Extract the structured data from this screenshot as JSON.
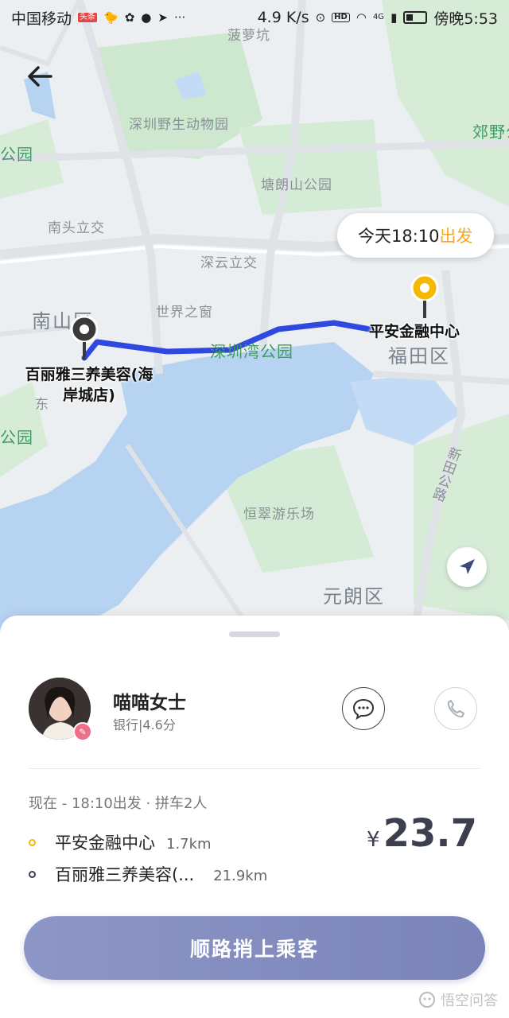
{
  "status_bar": {
    "carrier": "中国移动",
    "news_badge": "头条",
    "speed": "4.9 K/s",
    "network": "4G",
    "hd": "HD",
    "time": "傍晚5:53"
  },
  "map": {
    "labels": {
      "bogang": "菠萝坑",
      "wildlife_park": "深圳野生动物园",
      "gongyuan_left": "公园",
      "tanglang_park": "塘朗山公园",
      "nantou": "南头立交",
      "shenyun": "深云立交",
      "nanshan": "南山区",
      "window_world": "世界之窗",
      "bay_park": "深圳湾公园",
      "futian": "福田区",
      "dong": "东",
      "gongyuan_left2": "公园",
      "hengcui": "恒翠游乐场",
      "yuanlang": "元朗区",
      "xintian": "新田公路",
      "jiaoye": "郊野公"
    },
    "depart_bubble": {
      "prefix": "今天18:10",
      "accent": "出发"
    },
    "destination_pin_label": "平安金融中心",
    "origin_pin_label_line1": "百丽雅三养美容(海",
    "origin_pin_label_line2": "岸城店)",
    "colors": {
      "route": "#2f48e0",
      "water": "#b7d3f2",
      "park": "#cde8cf",
      "dest_pin": "#f5b800",
      "origin_pin": "#3a3a3a"
    }
  },
  "driver": {
    "name": "喵喵女士",
    "meta": "银行|4.6分"
  },
  "trip": {
    "summary": "现在 - 18:10出发 · 拼车2人",
    "stops": [
      {
        "name": "平安金融中心",
        "distance": "1.7km",
        "dot_color": "#f5b800"
      },
      {
        "name": "百丽雅三养美容(...",
        "distance": "21.9km",
        "dot_color": "#3b3f4e"
      }
    ],
    "currency": "¥",
    "fare": "23.7"
  },
  "actions": {
    "pickup_label": "顺路捎上乘客"
  },
  "watermark": "悟空问答"
}
